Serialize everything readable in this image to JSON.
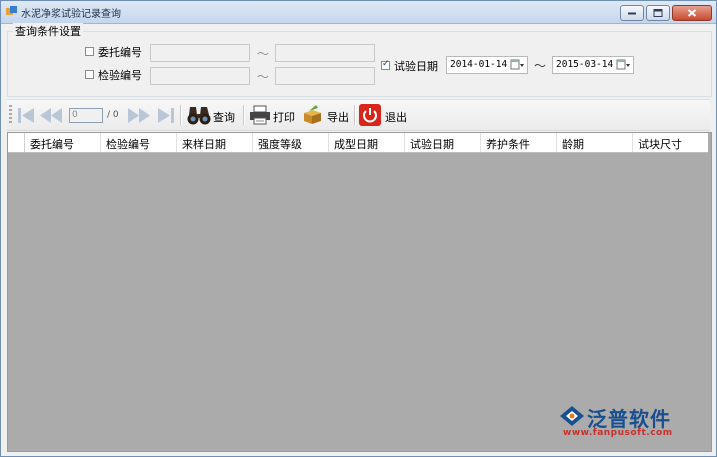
{
  "window": {
    "title": "水泥净浆试验记录查询",
    "controls": [
      "minimize",
      "maximize",
      "close"
    ]
  },
  "query_group": {
    "legend": "查询条件设置",
    "fields": [
      {
        "label": "委托编号",
        "checked": false,
        "from_value": "",
        "to_value": ""
      },
      {
        "label": "检验编号",
        "checked": false,
        "from_value": "",
        "to_value": ""
      }
    ],
    "range_separator": "～",
    "date_filter": {
      "label": "试验日期",
      "checked": true,
      "start": "2014-01-14",
      "end": "2015-03-14"
    }
  },
  "toolbar": {
    "page_input": "0",
    "page_total": "/ 0",
    "query_label": "查询",
    "print_label": "打印",
    "export_label": "导出",
    "exit_label": "退出"
  },
  "grid": {
    "columns": [
      "委托编号",
      "检验编号",
      "来样日期",
      "强度等级",
      "成型日期",
      "试验日期",
      "养护条件",
      "龄期",
      "试块尺寸"
    ],
    "rows": []
  },
  "watermark": {
    "brand": "泛普软件",
    "url": "www.fanpusoft.com"
  },
  "colors": {
    "grid_background": "#ababab",
    "title_gradient_top": "#dfe9f5",
    "exit_red": "#d9261c",
    "brand_blue": "#1a4f8f"
  }
}
